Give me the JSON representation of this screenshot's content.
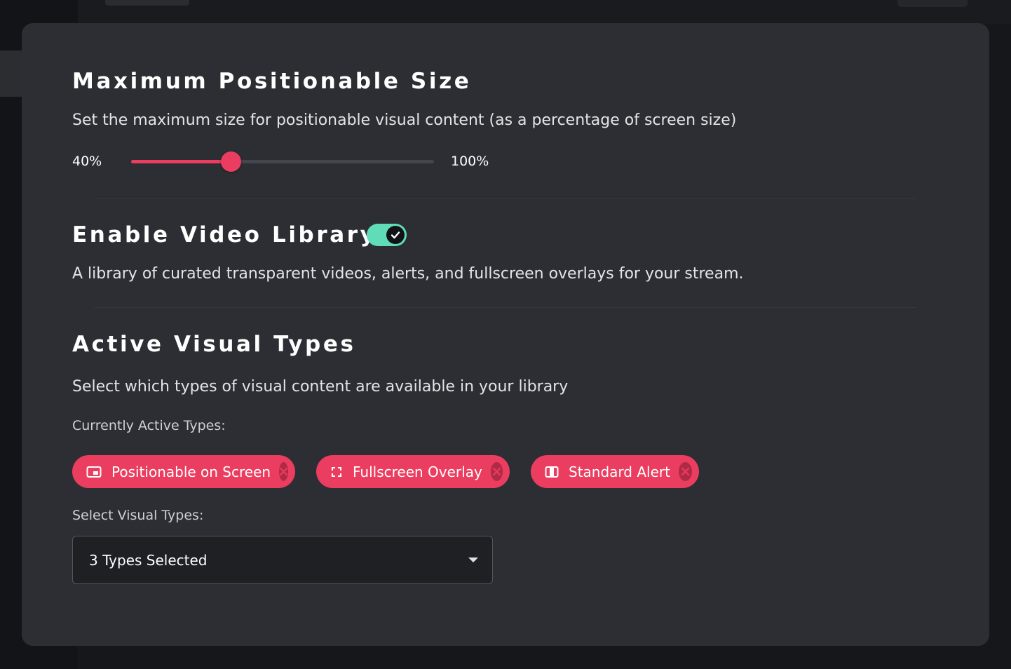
{
  "max_size": {
    "title": "Maximum Positionable Size",
    "description": "Set the maximum size for positionable visual content (as a percentage of screen size)",
    "min_label": "40%",
    "max_label": "100%",
    "value_fraction": 0.33
  },
  "video_library": {
    "title": "Enable Video Library",
    "enabled": true,
    "description": "A library of curated transparent videos, alerts, and fullscreen overlays for your stream."
  },
  "visual_types": {
    "title": "Active Visual Types",
    "description": "Select which types of visual content are available in your library",
    "active_label": "Currently Active Types:",
    "chips": [
      {
        "label": "Positionable on Screen",
        "icon": "picture-in-picture-icon"
      },
      {
        "label": "Fullscreen Overlay",
        "icon": "fullscreen-icon"
      },
      {
        "label": "Standard Alert",
        "icon": "alert-layout-icon"
      }
    ],
    "select_label": "Select Visual Types:",
    "select_value": "3 Types Selected"
  },
  "colors": {
    "accent": "#ea3d5f",
    "toggle_on": "#5fdcb8",
    "panel": "#2d2e33"
  }
}
